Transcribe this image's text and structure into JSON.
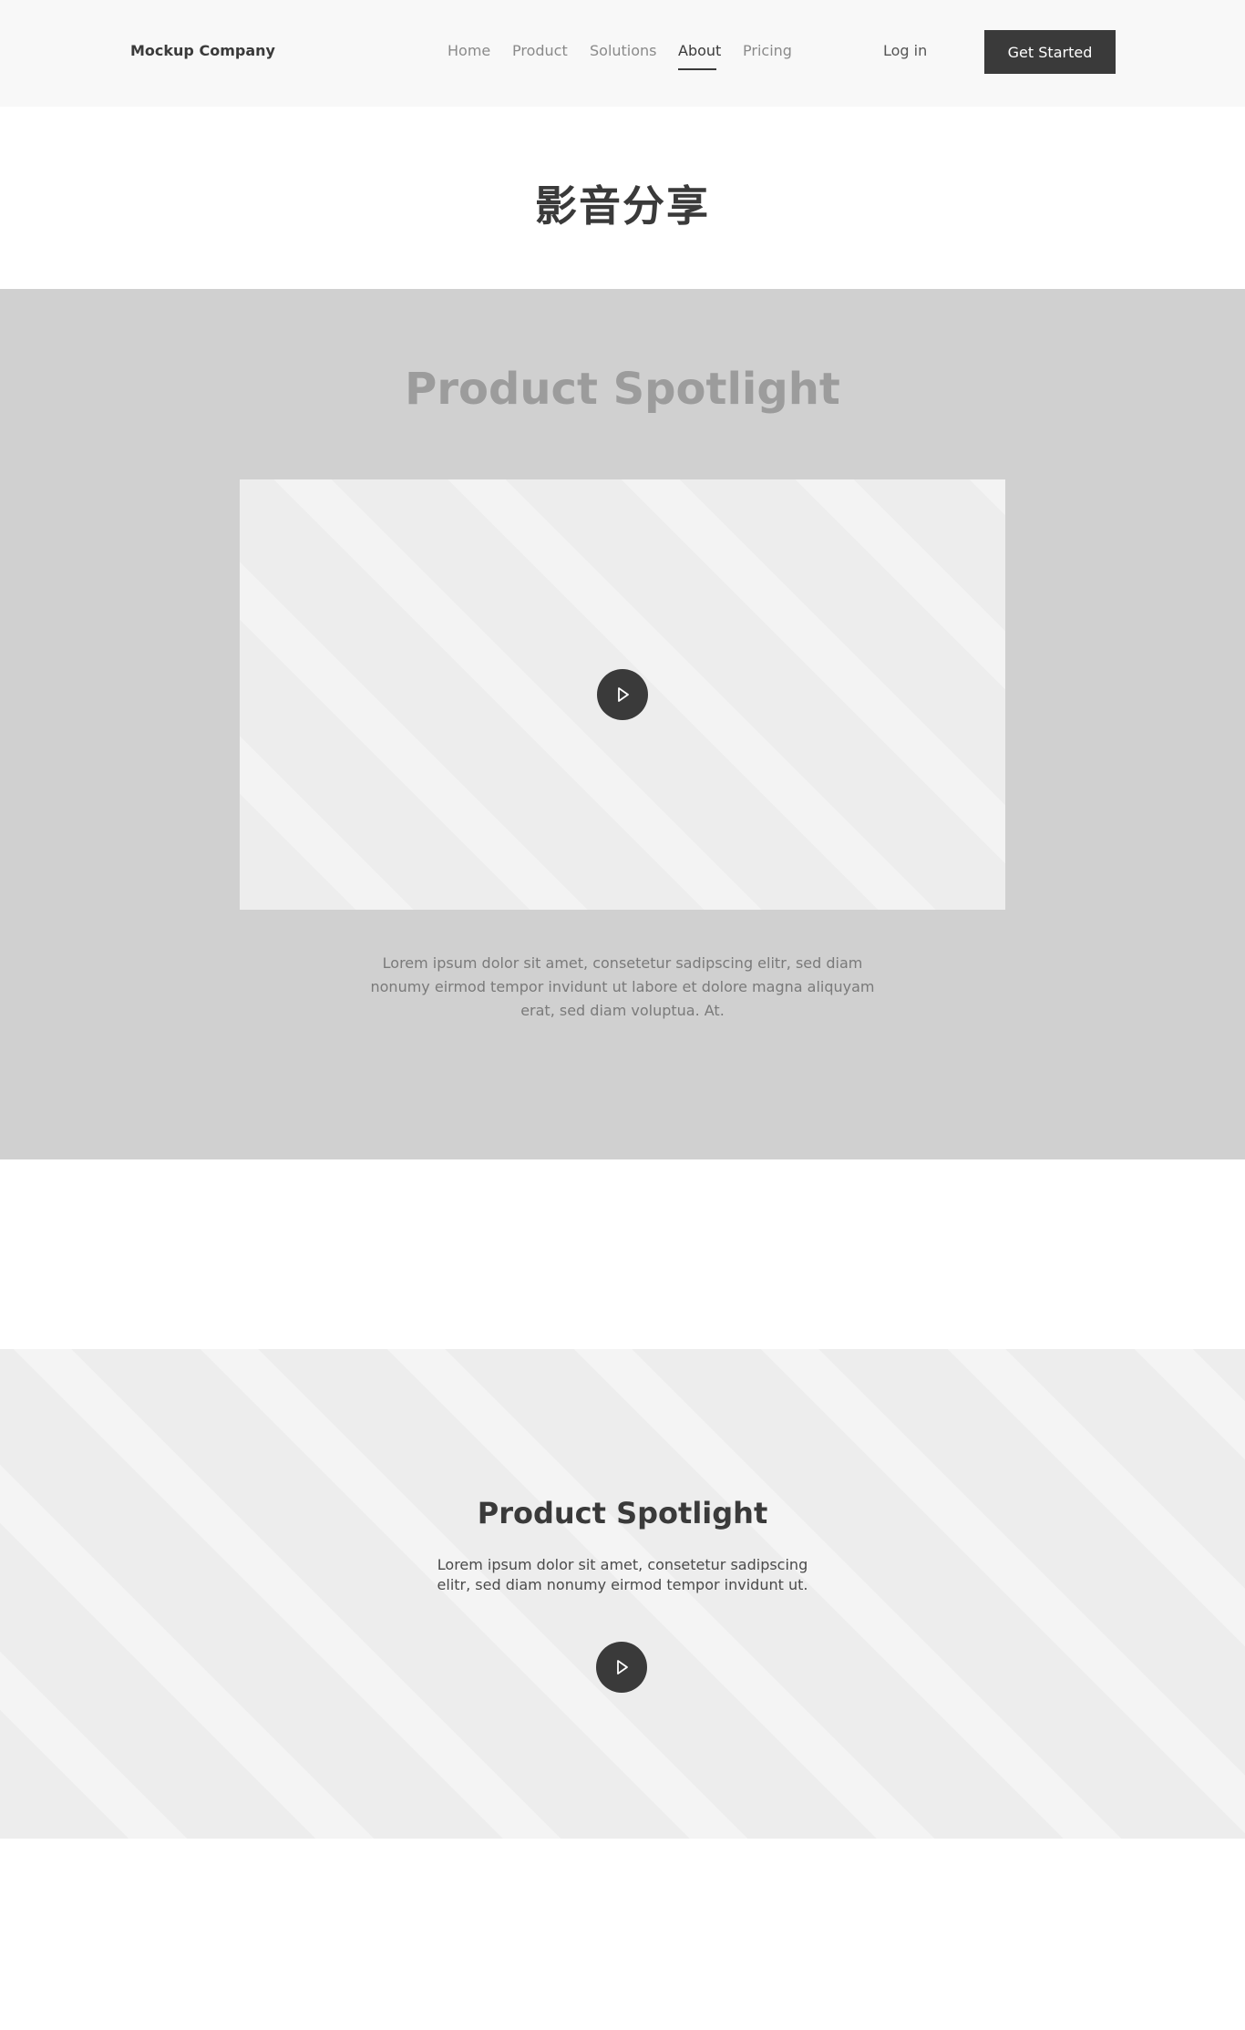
{
  "header": {
    "brand": "Mockup Company",
    "nav": [
      {
        "label": "Home"
      },
      {
        "label": "Product"
      },
      {
        "label": "Solutions"
      },
      {
        "label": "About",
        "active": true
      },
      {
        "label": "Pricing"
      }
    ],
    "login_label": "Log in",
    "cta_label": "Get Started"
  },
  "page_title": "影音分享",
  "spotlight_video": {
    "title": "Product Spotlight",
    "play_icon": "play-icon",
    "description": "Lorem ipsum dolor sit amet, consetetur sadipscing elitr, sed diam nonumy eirmod tempor invidunt ut labore et dolore magna aliquyam erat, sed diam voluptua. At."
  },
  "spotlight_banner": {
    "title": "Product Spotlight",
    "description": "Lorem ipsum dolor sit amet, consetetur sadipscing elitr, sed diam nonumy eirmod tempor invidunt ut.",
    "play_icon": "play-icon"
  },
  "colors": {
    "header_bg": "#f8f8f8",
    "dark": "#3a3a3a",
    "section_gray": "#d0d0d0",
    "stripe_light": "#ededed",
    "stripe_lighter": "#f3f3f3"
  }
}
